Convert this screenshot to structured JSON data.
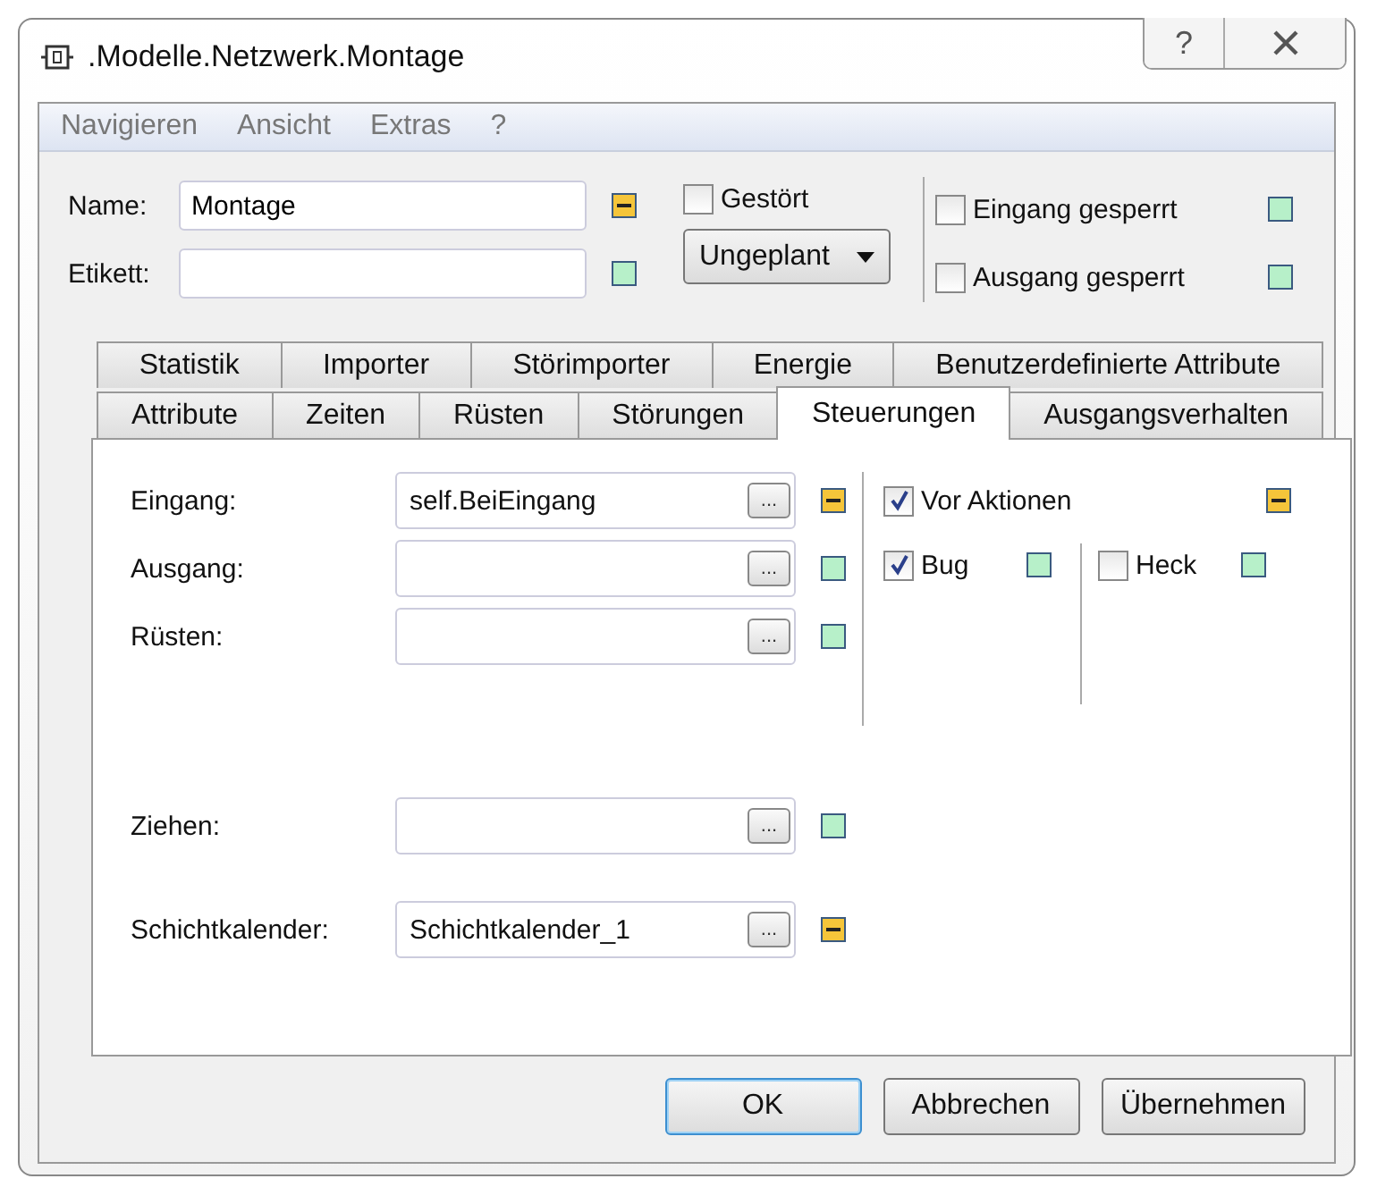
{
  "window": {
    "title": ".Modelle.Netzwerk.Montage",
    "help": "?"
  },
  "menu": [
    {
      "label": "Navigieren"
    },
    {
      "label": "Ansicht"
    },
    {
      "label": "Extras"
    },
    {
      "label": "?"
    }
  ],
  "header_fields": [
    {
      "label": "Name:",
      "value": "Montage",
      "local": true
    },
    {
      "label": "Etikett:",
      "local": false
    }
  ],
  "failed": {
    "label": "Gestört",
    "checked": false
  },
  "dropdown": {
    "value": "Ungeplant"
  },
  "blocks": [
    {
      "label": "Eingang gesperrt",
      "checked": false,
      "local": false
    },
    {
      "label": "Ausgang gesperrt",
      "checked": false,
      "local": false
    }
  ],
  "tab_rows": [
    [
      {
        "label": "Statistik",
        "selected": false
      },
      {
        "label": "Importer",
        "selected": false
      },
      {
        "label": "Störimporter",
        "selected": false
      },
      {
        "label": "Energie",
        "selected": false
      },
      {
        "label": "Benutzerdefinierte Attribute",
        "selected": false
      }
    ],
    [
      {
        "label": "Attribute",
        "selected": false
      },
      {
        "label": "Zeiten",
        "selected": false
      },
      {
        "label": "Rüsten",
        "selected": false
      },
      {
        "label": "Störungen",
        "selected": false
      },
      {
        "label": "Steuerungen",
        "selected": true
      },
      {
        "label": "Ausgangsverhalten",
        "selected": false
      }
    ]
  ],
  "controls": [
    {
      "label": "Eingang:",
      "value": "self.BeiEingang",
      "browse": "...",
      "local": true
    },
    {
      "label": "Ausgang:",
      "browse": "...",
      "local": false
    },
    {
      "label": "Rüsten:",
      "browse": "...",
      "local": false
    }
  ],
  "controls_lower": [
    {
      "label": "Ziehen:",
      "browse": "...",
      "local": false
    },
    {
      "label": "Schichtkalender:",
      "value": "Schichtkalender_1",
      "browse": "...",
      "local": true
    }
  ],
  "before_actions": {
    "label": "Vor Aktionen",
    "checked": true,
    "local": true
  },
  "sides": [
    {
      "label": "Bug",
      "checked": true,
      "local": false
    },
    {
      "label": "Heck",
      "checked": false,
      "local": false
    }
  ],
  "buttons": [
    {
      "label": "OK",
      "default": true
    },
    {
      "label": "Abbrechen",
      "default": false
    },
    {
      "label": "Übernehmen",
      "default": false
    }
  ]
}
